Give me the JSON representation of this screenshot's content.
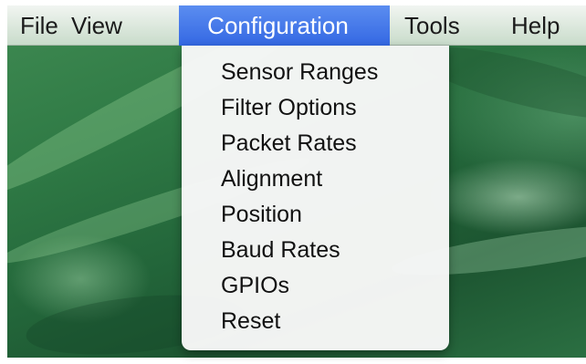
{
  "menubar": {
    "items": [
      "File",
      "View",
      "Configuration",
      "Tools",
      "Help"
    ],
    "active": "Configuration",
    "active_color": "#3f74e8"
  },
  "configuration_menu": {
    "items": [
      "Sensor Ranges",
      "Filter Options",
      "Packet Rates",
      "Alignment",
      "Position",
      "Baud Rates",
      "GPIOs",
      "Reset"
    ]
  }
}
